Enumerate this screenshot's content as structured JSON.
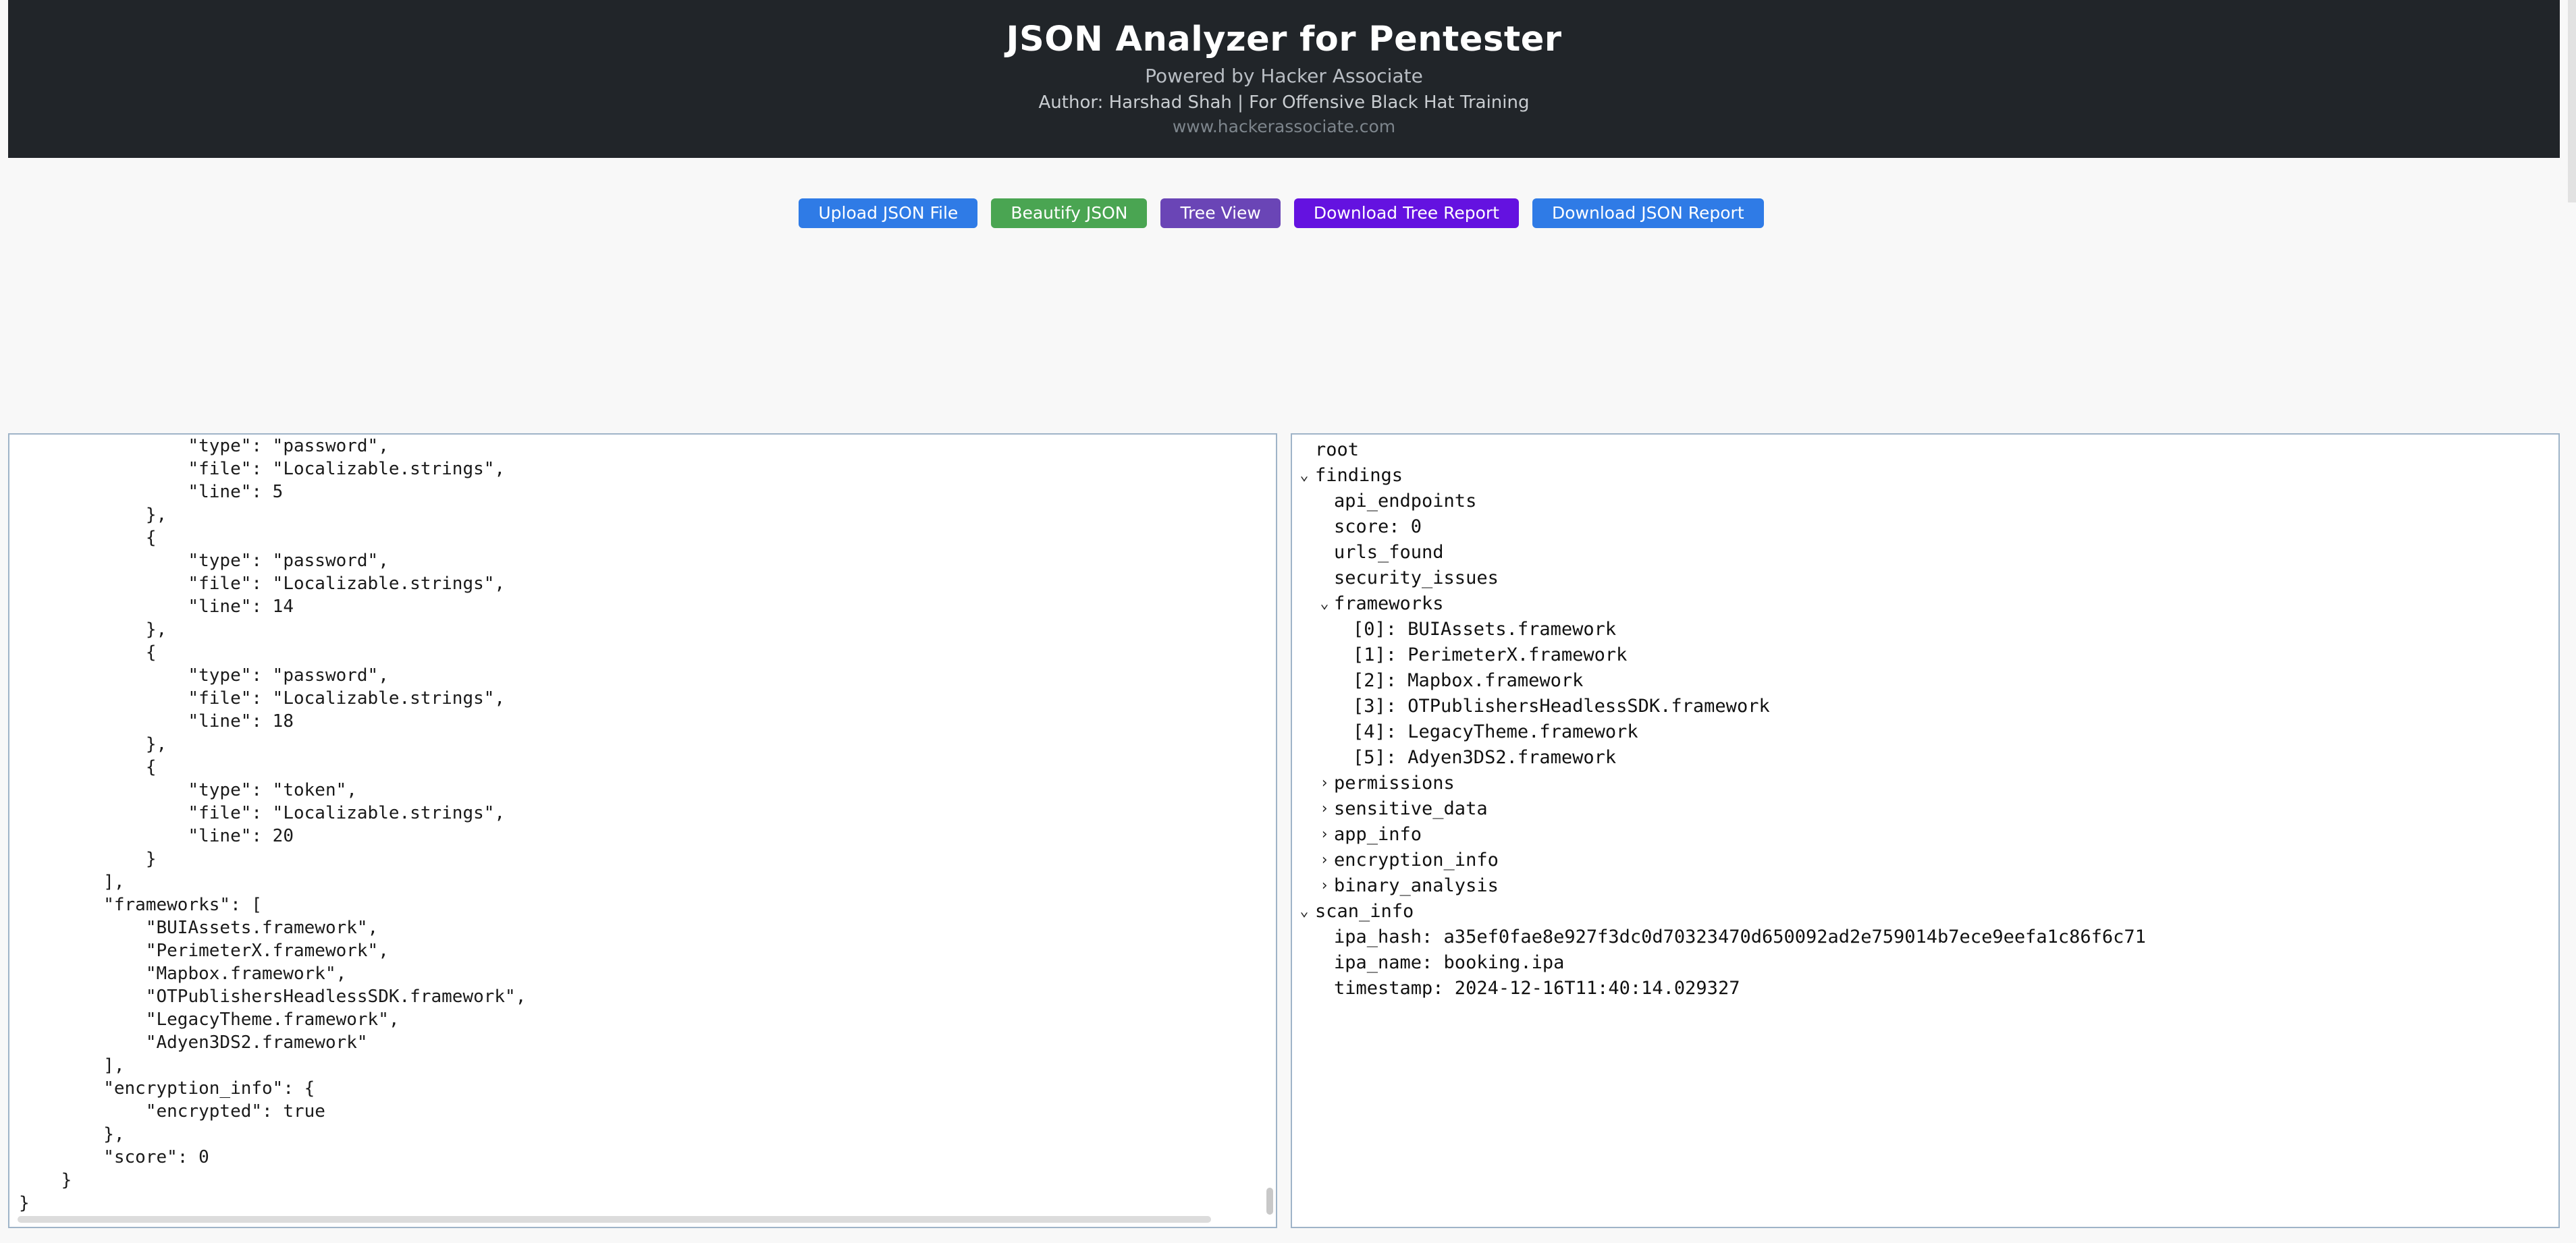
{
  "header": {
    "title": "JSON Analyzer for Pentester",
    "subtitle": "Powered by Hacker Associate",
    "author": "Author: Harshad Shah | For Offensive Black Hat Training",
    "site": "www.hackerassociate.com"
  },
  "toolbar": {
    "upload": "Upload JSON File",
    "beautify": "Beautify JSON",
    "tree_view": "Tree View",
    "download_tree": "Download Tree Report",
    "download_json": "Download JSON Report"
  },
  "colors": {
    "header_bg": "#212529",
    "upload": "#2f7be6",
    "beautify": "#4aa552",
    "tree_view": "#6a45b6",
    "download_tree": "#6412e0",
    "download_json": "#2f7be6"
  },
  "editor": {
    "lines": [
      "                \"type\": \"password\",",
      "                \"file\": \"Localizable.strings\",",
      "                \"line\": 5",
      "            },",
      "            {",
      "                \"type\": \"password\",",
      "                \"file\": \"Localizable.strings\",",
      "                \"line\": 14",
      "            },",
      "            {",
      "                \"type\": \"password\",",
      "                \"file\": \"Localizable.strings\",",
      "                \"line\": 18",
      "            },",
      "            {",
      "                \"type\": \"token\",",
      "                \"file\": \"Localizable.strings\",",
      "                \"line\": 20",
      "            }",
      "        ],",
      "        \"frameworks\": [",
      "            \"BUIAssets.framework\",",
      "            \"PerimeterX.framework\",",
      "            \"Mapbox.framework\",",
      "            \"OTPublishersHeadlessSDK.framework\",",
      "            \"LegacyTheme.framework\",",
      "            \"Adyen3DS2.framework\"",
      "        ],",
      "        \"encryption_info\": {",
      "            \"encrypted\": true",
      "        },",
      "        \"score\": 0",
      "    }",
      "}"
    ]
  },
  "tree": {
    "rows": [
      {
        "label": "root",
        "arrow": "",
        "level": 0
      },
      {
        "label": "findings",
        "arrow": "down",
        "level": 0
      },
      {
        "label": "api_endpoints",
        "arrow": "",
        "level": 1
      },
      {
        "label": "score: 0",
        "arrow": "",
        "level": 1
      },
      {
        "label": "urls_found",
        "arrow": "",
        "level": 1
      },
      {
        "label": "security_issues",
        "arrow": "",
        "level": 1
      },
      {
        "label": "frameworks",
        "arrow": "down",
        "level": 1
      },
      {
        "label": "[0]: BUIAssets.framework",
        "arrow": "",
        "level": 2
      },
      {
        "label": "[1]: PerimeterX.framework",
        "arrow": "",
        "level": 2
      },
      {
        "label": "[2]: Mapbox.framework",
        "arrow": "",
        "level": 2
      },
      {
        "label": "[3]: OTPublishersHeadlessSDK.framework",
        "arrow": "",
        "level": 2
      },
      {
        "label": "[4]: LegacyTheme.framework",
        "arrow": "",
        "level": 2
      },
      {
        "label": "[5]: Adyen3DS2.framework",
        "arrow": "",
        "level": 2
      },
      {
        "label": "permissions",
        "arrow": "right",
        "level": 1
      },
      {
        "label": "sensitive_data",
        "arrow": "right",
        "level": 1
      },
      {
        "label": "app_info",
        "arrow": "right",
        "level": 1
      },
      {
        "label": "encryption_info",
        "arrow": "right",
        "level": 1
      },
      {
        "label": "binary_analysis",
        "arrow": "right",
        "level": 1
      },
      {
        "label": "scan_info",
        "arrow": "down",
        "level": 0
      },
      {
        "label": "ipa_hash: a35ef0fae8e927f3dc0d70323470d650092ad2e759014b7ece9eefa1c86f6c71",
        "arrow": "",
        "level": 1
      },
      {
        "label": "ipa_name: booking.ipa",
        "arrow": "",
        "level": 1
      },
      {
        "label": "timestamp: 2024-12-16T11:40:14.029327",
        "arrow": "",
        "level": 1
      }
    ]
  }
}
